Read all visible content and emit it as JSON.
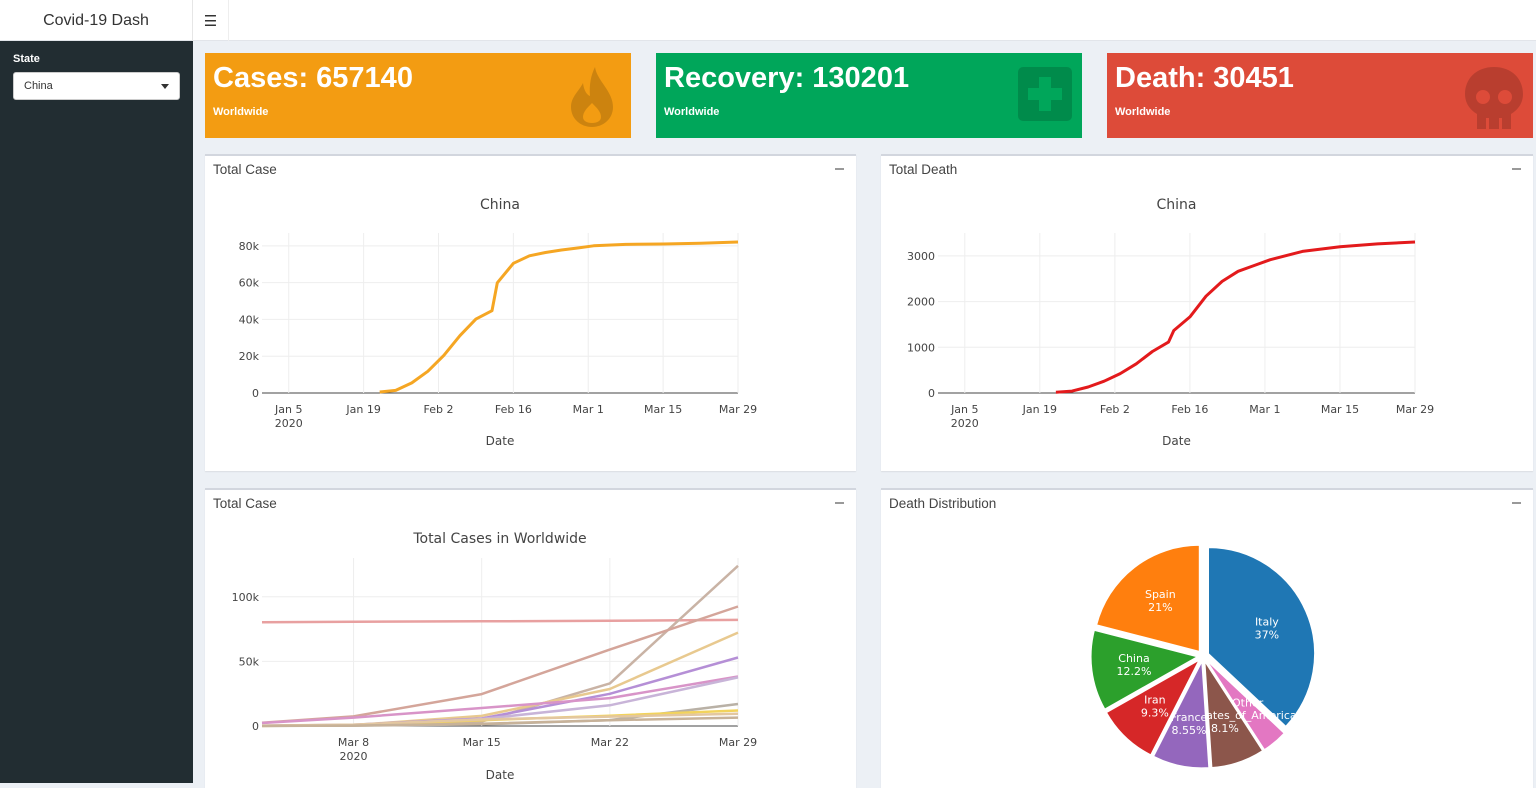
{
  "app": {
    "title": "Covid-19 Dash",
    "menu_icon": "hamburger-icon"
  },
  "sidebar": {
    "state_label": "State",
    "state_value": "China"
  },
  "value_boxes": [
    {
      "value": "Cases: 657140",
      "subtitle": "Worldwide",
      "color": "#f39c12",
      "icon": "fire-icon"
    },
    {
      "value": "Recovery: 130201",
      "subtitle": "Worldwide",
      "color": "#00a65a",
      "icon": "medkit-icon"
    },
    {
      "value": "Death: 30451",
      "subtitle": "Worldwide",
      "color": "#dd4b39",
      "icon": "skull-icon"
    }
  ],
  "panels": {
    "p1": "Total Case",
    "p2": "Total Death",
    "p3": "Total Case",
    "p4": "Death Distribution"
  },
  "chart_data": [
    {
      "type": "line",
      "title": "China",
      "xlabel": "Date",
      "ylabel": "",
      "x": [
        "2020-01-22",
        "2020-01-25",
        "2020-01-28",
        "2020-01-31",
        "2020-02-03",
        "2020-02-06",
        "2020-02-09",
        "2020-02-12",
        "2020-02-13",
        "2020-02-16",
        "2020-02-19",
        "2020-02-22",
        "2020-02-25",
        "2020-02-28",
        "2020-03-02",
        "2020-03-08",
        "2020-03-15",
        "2020-03-22",
        "2020-03-29"
      ],
      "xticks": [
        "Jan 5\n2020",
        "Jan 19",
        "Feb 2",
        "Feb 16",
        "Mar 1",
        "Mar 15",
        "Mar 29"
      ],
      "yticks": [
        "0",
        "20k",
        "40k",
        "60k",
        "80k"
      ],
      "ylim": [
        0,
        87000
      ],
      "series": [
        {
          "color": "#f5a623",
          "values": [
            548,
            1406,
            5509,
            11821,
            20438,
            31161,
            40171,
            44759,
            59895,
            70513,
            74577,
            76397,
            77754,
            78824,
            80026,
            80804,
            81003,
            81435,
            82122
          ]
        }
      ]
    },
    {
      "type": "line",
      "title": "China",
      "xlabel": "Date",
      "ylabel": "",
      "x": [
        "2020-01-22",
        "2020-01-25",
        "2020-01-28",
        "2020-01-31",
        "2020-02-03",
        "2020-02-06",
        "2020-02-09",
        "2020-02-12",
        "2020-02-13",
        "2020-02-16",
        "2020-02-19",
        "2020-02-22",
        "2020-02-25",
        "2020-02-28",
        "2020-03-02",
        "2020-03-08",
        "2020-03-15",
        "2020-03-22",
        "2020-03-29"
      ],
      "xticks": [
        "Jan 5\n2020",
        "Jan 19",
        "Feb 2",
        "Feb 16",
        "Mar 1",
        "Mar 15",
        "Mar 29"
      ],
      "yticks": [
        "0",
        "1000",
        "2000",
        "3000"
      ],
      "ylim": [
        0,
        3500
      ],
      "series": [
        {
          "color": "#e31a1c",
          "values": [
            17,
            42,
            132,
            259,
            425,
            638,
            908,
            1113,
            1367,
            1665,
            2118,
            2442,
            2663,
            2788,
            2915,
            3097,
            3199,
            3261,
            3304
          ]
        }
      ]
    },
    {
      "type": "line",
      "title": "Total Cases in Worldwide",
      "xlabel": "Date",
      "ylabel": "",
      "x": [
        "2020-03-03",
        "2020-03-08",
        "2020-03-15",
        "2020-03-22",
        "2020-03-29"
      ],
      "xticks": [
        "Mar 8\n2020",
        "Mar 15",
        "Mar 22",
        "Mar 29"
      ],
      "yticks": [
        "0",
        "50k",
        "100k"
      ],
      "ylim": [
        0,
        130000
      ],
      "series": [
        {
          "color": "#e8a0a0",
          "values": [
            80270,
            80700,
            81000,
            81400,
            82100
          ]
        },
        {
          "color": "#c9b3a5",
          "values": [
            100,
            400,
            3500,
            33000,
            124000
          ]
        },
        {
          "color": "#d4a59a",
          "values": [
            2500,
            7400,
            24700,
            59100,
            92500
          ]
        },
        {
          "color": "#e8c98f",
          "values": [
            150,
            670,
            7800,
            28600,
            72300
          ]
        },
        {
          "color": "#b58fd6",
          "values": [
            200,
            1000,
            5800,
            24900,
            53000
          ]
        },
        {
          "color": "#d894c8",
          "values": [
            2300,
            6500,
            13900,
            21600,
            38300
          ]
        },
        {
          "color": "#c8b4d8",
          "values": [
            200,
            700,
            5400,
            16000,
            37600
          ]
        },
        {
          "color": "#b9b1a6",
          "values": [
            50,
            300,
            1200,
            4600,
            17000
          ]
        },
        {
          "color": "#f2d35c",
          "values": [
            100,
            700,
            4500,
            8000,
            12000
          ]
        },
        {
          "color": "#e3c7a0",
          "values": [
            300,
            1100,
            5000,
            7300,
            9500
          ]
        },
        {
          "color": "#c7b299",
          "values": [
            50,
            300,
            1800,
            4500,
            6500
          ]
        }
      ]
    },
    {
      "type": "pie",
      "title": "",
      "slices": [
        {
          "label": "Italy",
          "pct": "37%",
          "value": 37,
          "color": "#1f77b4"
        },
        {
          "label": "Other",
          "pct": "",
          "value": 3.85,
          "color": "#e377c2"
        },
        {
          "label": "United_States_of_America",
          "pct": "8.1%",
          "value": 8.1,
          "color": "#8c564b"
        },
        {
          "label": "France",
          "pct": "8.55%",
          "value": 8.55,
          "color": "#9467bd"
        },
        {
          "label": "Iran",
          "pct": "9.3%",
          "value": 9.3,
          "color": "#d62728"
        },
        {
          "label": "China",
          "pct": "12.2%",
          "value": 12.2,
          "color": "#2ca02c"
        },
        {
          "label": "Spain",
          "pct": "21%",
          "value": 21,
          "color": "#ff7f0e"
        }
      ]
    }
  ]
}
